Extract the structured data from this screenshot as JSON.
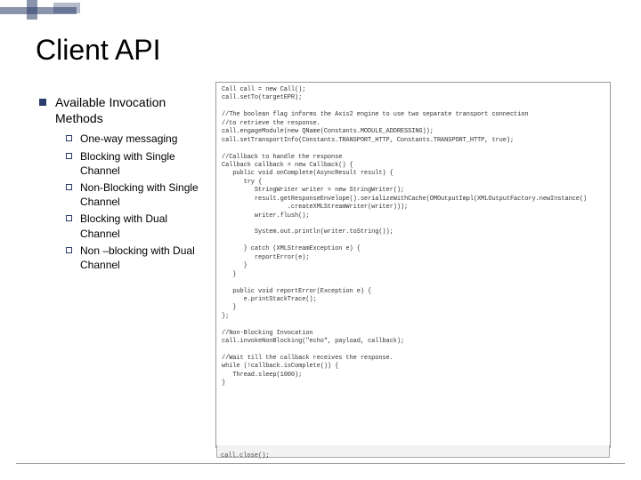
{
  "title": "Client API",
  "heading": "Available Invocation Methods",
  "items": [
    "One-way messaging",
    "Blocking with Single Channel",
    "Non-Blocking with Single Channel",
    "Blocking with Dual Channel",
    "Non –blocking with Dual Channel"
  ],
  "code": "Call call = new Call();\ncall.setTo(targetEPR);\n\n//The boolean flag informs the Axis2 engine to use two separate transport connection\n//to retrieve the response.\ncall.engageModule(new QName(Constants.MODULE_ADDRESSING));\ncall.setTransportInfo(Constants.TRANSPORT_HTTP, Constants.TRANSPORT_HTTP, true);\n\n//Callback to handle the response\nCallback callback = new Callback() {\n   public void onComplete(AsyncResult result) {\n      try {\n         StringWriter writer = new StringWriter();\n         result.getResponseEnvelope().serializeWithCache(OMOutputImpl(XMLOutputFactory.newInstance()\n                  .createXMLStreamWriter(writer)));\n         writer.flush();\n\n         System.out.println(writer.toString());\n\n      } catch (XMLStreamException e) {\n         reportError(e);\n      }\n   }\n\n   public void reportError(Exception e) {\n      e.printStackTrace();\n   }\n};\n\n//Non-Blocking Invocation\ncall.invokeNonBlocking(\"echo\", payload, callback);\n\n//Wait till the callback receives the response.\nwhile (!callback.isComplete()) {\n   Thread.sleep(1000);\n}\n",
  "code_footer": "call.close();"
}
